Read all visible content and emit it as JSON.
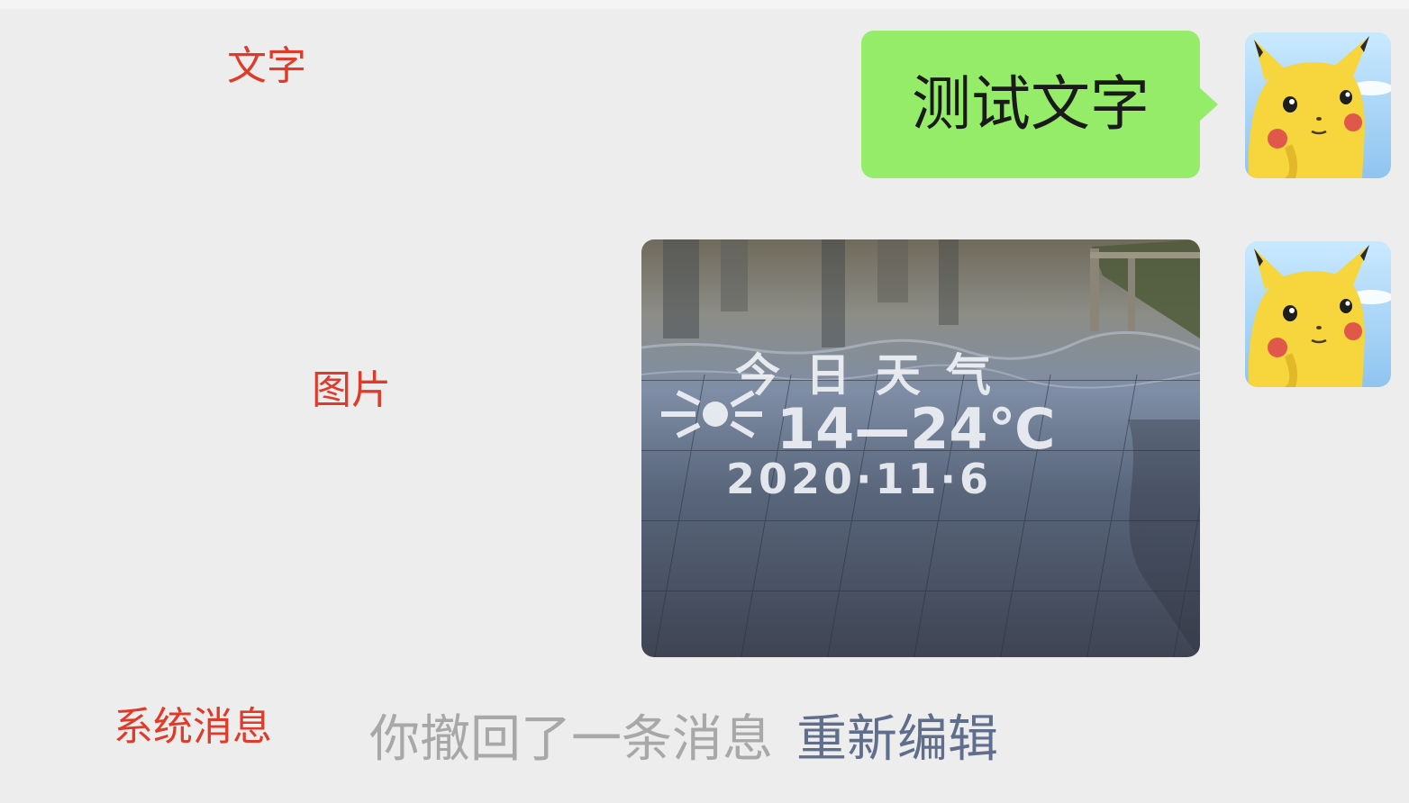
{
  "annotations": {
    "text_label": "文字",
    "image_label": "图片",
    "system_label": "系统消息"
  },
  "messages": {
    "text_message": "测试文字",
    "image_message": {
      "photo_lines": [
        "今日天气",
        "14—24℃",
        "2020·11·6"
      ]
    },
    "system_message": {
      "text": "你撤回了一条消息",
      "link": "重新编辑"
    }
  },
  "colors": {
    "background": "#ededed",
    "annotation": "#e03b2a",
    "bubble": "#95ec69",
    "system_text": "#a8a8a8",
    "system_link": "#5f6e8c"
  },
  "icons": {
    "avatar": "pikachu-avatar",
    "photo": "water-floor-photo"
  }
}
